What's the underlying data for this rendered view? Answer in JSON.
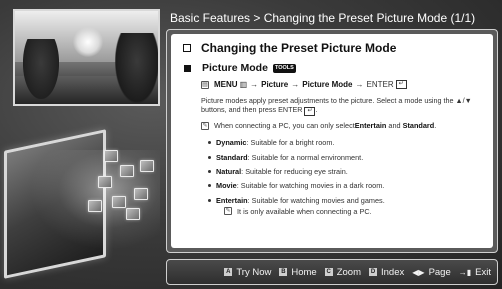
{
  "header": {
    "title": "Basic Features > Changing the Preset Picture Mode (1/1)"
  },
  "content": {
    "heading": "Changing the Preset Picture Mode",
    "subheading": "Picture Mode",
    "tools_badge": "TOOLS",
    "menu_path": {
      "menu": "MENU",
      "arrow1": "→",
      "picture": "Picture",
      "arrow2": "→",
      "picture_mode": "Picture Mode",
      "arrow3": "→",
      "enter": "ENTER"
    },
    "description": "Picture modes apply preset adjustments to the picture. Select a mode using the ▲/▼ buttons, and then press ENTER",
    "note": {
      "prefix": "When connecting a PC, you can only select ",
      "entertain": "Entertain",
      "and": " and ",
      "standard": "Standard",
      "suffix": "."
    },
    "modes": [
      {
        "name": "Dynamic",
        "desc": ": Suitable for a bright room."
      },
      {
        "name": "Standard",
        "desc": ": Suitable for a normal environment."
      },
      {
        "name": "Natural",
        "desc": ": Suitable for reducing eye strain."
      },
      {
        "name": "Movie",
        "desc": ": Suitable for watching movies in a dark room."
      },
      {
        "name": "Entertain",
        "desc": ": Suitable for watching movies and games."
      }
    ],
    "subnote": "It is only available when connecting a PC."
  },
  "bottom_bar": {
    "try_now": {
      "key": "A",
      "label": "Try Now"
    },
    "home": {
      "key": "B",
      "label": "Home"
    },
    "zoom": {
      "key": "C",
      "label": "Zoom"
    },
    "index": {
      "key": "D",
      "label": "Index"
    },
    "page": {
      "key": "◀▶",
      "label": "Page"
    },
    "exit": {
      "key": "→▮",
      "label": "Exit"
    }
  },
  "colors": {
    "background": "#3b3b3b",
    "panel_border": "#d0d0d0",
    "text_dark": "#111111"
  }
}
